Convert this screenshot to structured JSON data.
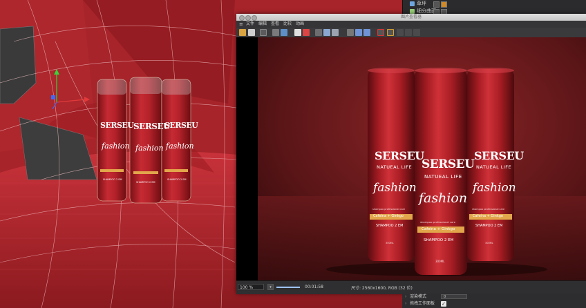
{
  "object_manager": {
    "rows": [
      {
        "label": "草坪"
      },
      {
        "label": "细分曲面"
      }
    ]
  },
  "picture_viewer": {
    "title": "图片查看器",
    "menu": [
      "文件",
      "编辑",
      "查看",
      "比较",
      "动画"
    ],
    "image": {
      "products": [
        {
          "brand": "SERSEU",
          "line": "NATUEAL LIFE",
          "name": "fashion",
          "sub": "shampoo professional care",
          "tag": "Cafeína + Ginkgo",
          "product": "SHAMPOO 2 EM",
          "volume": "300ML"
        },
        {
          "brand": "SERSEU",
          "line": "NATUEAL LIFE",
          "name": "fashion",
          "sub": "shampoo professional care",
          "tag": "Cafeína + Ginkgo",
          "product": "SHAMPOO 2 EM",
          "volume": "300ML"
        },
        {
          "brand": "SERSEU",
          "line": "NATUEAL LIFE",
          "name": "fashion",
          "sub": "shampoo professional care",
          "tag": "Cafeína + Ginkgo",
          "product": "SHAMPOO 2 EM",
          "volume": "300ML"
        }
      ]
    },
    "status": {
      "zoom": "100 %",
      "render_progress": 1.0,
      "time": "00:01:58",
      "info": "尺寸: 2560x1600, RGB (32 位)"
    }
  },
  "viewport": {
    "bottles": [
      {
        "brand": "SERSEU",
        "name": "fashion",
        "product": "SHAMPOO 2 EM"
      },
      {
        "brand": "SERSEU",
        "name": "fashion",
        "product": "SHAMPOO 2 EM"
      },
      {
        "brand": "SERSEU",
        "name": "fashion",
        "product": "SHAMPOO 2 EM"
      }
    ]
  },
  "attributes": {
    "rows": [
      {
        "label": "渲染模式",
        "value": "0"
      },
      {
        "label": "拖拽工作面板",
        "checked": true
      }
    ]
  },
  "colors": {
    "bottle_red": "#b3202a",
    "gold_label": "#e2a64b",
    "viewer_bg": "#2e2e30"
  }
}
